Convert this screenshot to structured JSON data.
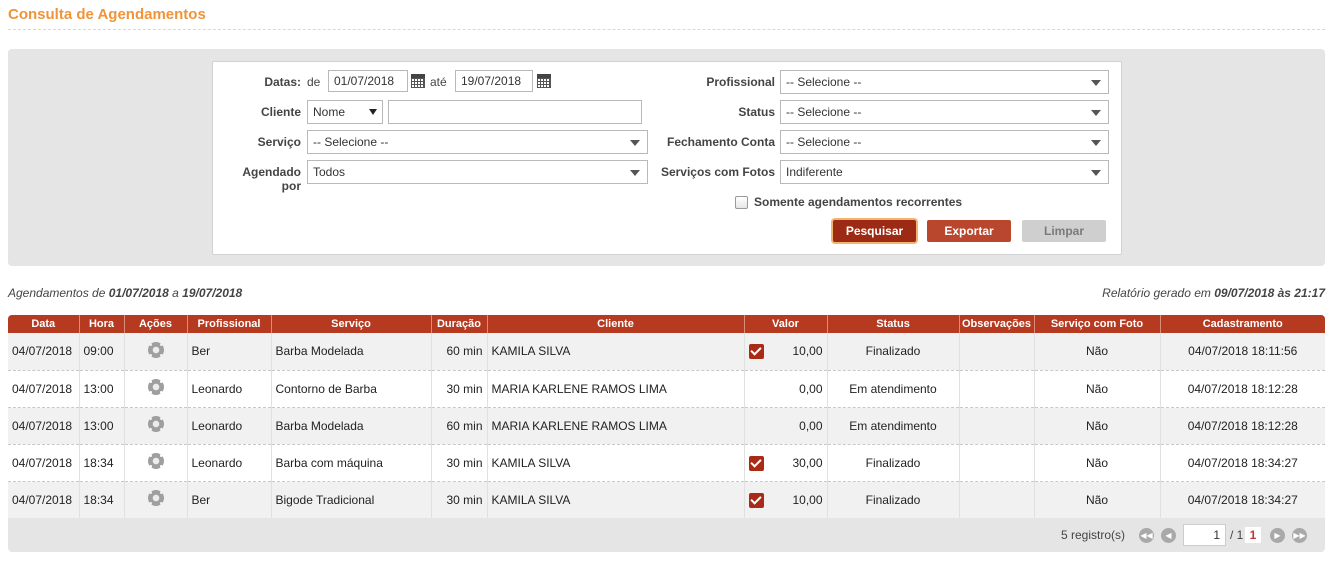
{
  "page": {
    "title": "Consulta de Agendamentos"
  },
  "filters": {
    "datas_label": "Datas:",
    "de_label": "de",
    "date_from": "01/07/2018",
    "ate_label": "até",
    "date_to": "19/07/2018",
    "cliente_label": "Cliente",
    "cliente_type": "Nome",
    "cliente_value": "",
    "servico_label": "Serviço",
    "servico_value": "-- Selecione --",
    "agendado_por_label_1": "Agendado",
    "agendado_por_label_2": "por",
    "agendado_por_value": "Todos",
    "profissional_label": "Profissional",
    "profissional_value": "-- Selecione --",
    "status_label": "Status",
    "status_value": "-- Selecione --",
    "fechamento_label": "Fechamento Conta",
    "fechamento_value": "-- Selecione --",
    "fotos_label": "Serviços com Fotos",
    "fotos_value": "Indiferente",
    "recorrentes_label": "Somente agendamentos recorrentes",
    "recorrentes_checked": false,
    "btn_pesquisar": "Pesquisar",
    "btn_exportar": "Exportar",
    "btn_limpar": "Limpar"
  },
  "summary": {
    "left_prefix": "Agendamentos de ",
    "left_from": "01/07/2018",
    "left_mid": " a ",
    "left_to": "19/07/2018",
    "right_prefix": "Relatório gerado em ",
    "right_value": "09/07/2018 às 21:17"
  },
  "table": {
    "headers": [
      "Data",
      "Hora",
      "Ações",
      "Profissional",
      "Serviço",
      "Duração",
      "Cliente",
      "Valor",
      "Status",
      "Observações",
      "Serviço com Foto",
      "Cadastramento"
    ],
    "rows": [
      {
        "data": "04/07/2018",
        "hora": "09:00",
        "profissional": "Ber",
        "servico": "Barba Modelada",
        "duracao": "60 min",
        "cliente": "KAMILA SILVA",
        "pago": true,
        "valor": "10,00",
        "status": "Finalizado",
        "observacoes": "",
        "foto": "Não",
        "cadastramento": "04/07/2018 18:11:56"
      },
      {
        "data": "04/07/2018",
        "hora": "13:00",
        "profissional": "Leonardo",
        "servico": "Contorno de Barba",
        "duracao": "30 min",
        "cliente": "MARIA KARLENE RAMOS LIMA",
        "pago": false,
        "valor": "0,00",
        "status": "Em atendimento",
        "observacoes": "",
        "foto": "Não",
        "cadastramento": "04/07/2018 18:12:28"
      },
      {
        "data": "04/07/2018",
        "hora": "13:00",
        "profissional": "Leonardo",
        "servico": "Barba Modelada",
        "duracao": "60 min",
        "cliente": "MARIA KARLENE RAMOS LIMA",
        "pago": false,
        "valor": "0,00",
        "status": "Em atendimento",
        "observacoes": "",
        "foto": "Não",
        "cadastramento": "04/07/2018 18:12:28"
      },
      {
        "data": "04/07/2018",
        "hora": "18:34",
        "profissional": "Leonardo",
        "servico": "Barba com máquina",
        "duracao": "30 min",
        "cliente": "KAMILA SILVA",
        "pago": true,
        "valor": "30,00",
        "status": "Finalizado",
        "observacoes": "",
        "foto": "Não",
        "cadastramento": "04/07/2018 18:34:27"
      },
      {
        "data": "04/07/2018",
        "hora": "18:34",
        "profissional": "Ber",
        "servico": "Bigode Tradicional",
        "duracao": "30 min",
        "cliente": "KAMILA SILVA",
        "pago": true,
        "valor": "10,00",
        "status": "Finalizado",
        "observacoes": "",
        "foto": "Não",
        "cadastramento": "04/07/2018 18:34:27"
      }
    ]
  },
  "pager": {
    "count_label": "5 registro(s)",
    "page_input": "1",
    "total_label": "/ 1",
    "current_page": "1"
  },
  "colors": {
    "accent": "#b53a1f",
    "title": "#f0943a"
  }
}
